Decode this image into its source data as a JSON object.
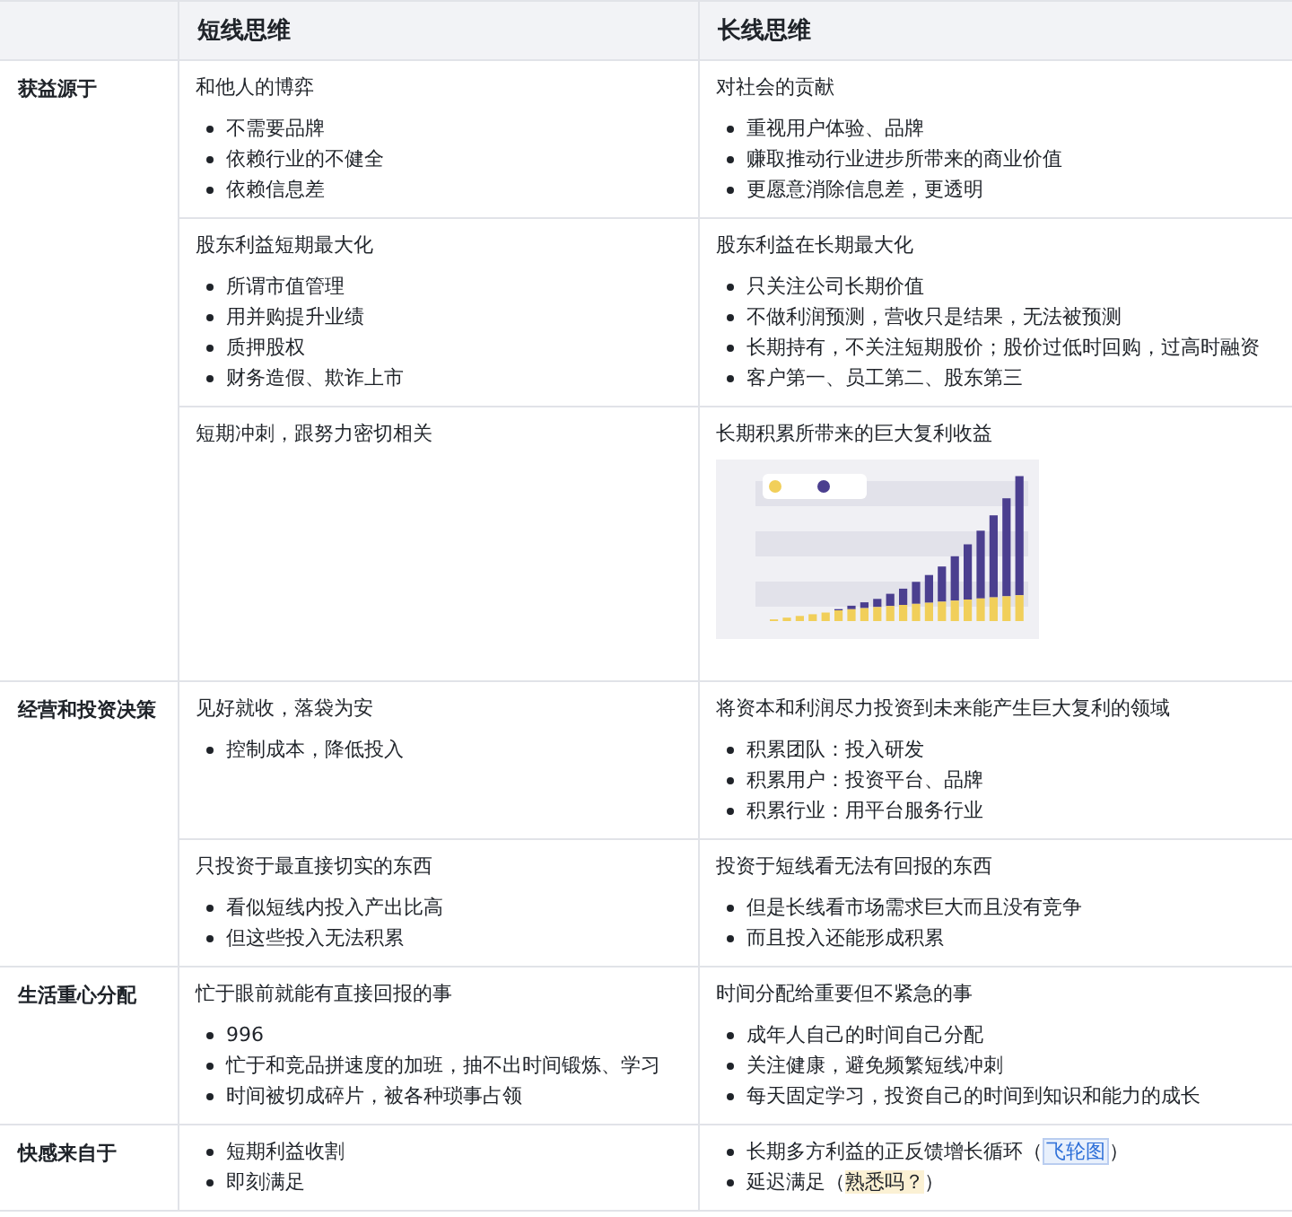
{
  "header": {
    "columns": [
      "短线思维",
      "长线思维"
    ]
  },
  "sections": [
    {
      "label": "获益源于",
      "rows": [
        {
          "short": {
            "title": "和他人的博弈",
            "bullets": [
              "不需要品牌",
              "依赖行业的不健全",
              "依赖信息差"
            ]
          },
          "long": {
            "title": "对社会的贡献",
            "bullets": [
              "重视用户体验、品牌",
              "赚取推动行业进步所带来的商业价值",
              "更愿意消除信息差，更透明"
            ]
          }
        },
        {
          "short": {
            "title": "股东利益短期最大化",
            "bullets": [
              "所谓市值管理",
              "用并购提升业绩",
              "质押股权",
              "财务造假、欺诈上市"
            ]
          },
          "long": {
            "title": "股东利益在长期最大化",
            "bullets": [
              "只关注公司长期价值",
              "不做利润预测，营收只是结果，无法被预测",
              "长期持有，不关注短期股价；股价过低时回购，过高时融资",
              "客户第一、员工第二、股东第三"
            ]
          }
        },
        {
          "short": {
            "title": "短期冲刺，跟努力密切相关"
          },
          "long": {
            "title": "长期积累所带来的巨大复利收益",
            "has_chart": true
          }
        }
      ]
    },
    {
      "label": "经营和投资决策",
      "rows": [
        {
          "short": {
            "title": "见好就收，落袋为安",
            "bullets": [
              "控制成本，降低投入"
            ]
          },
          "long": {
            "title": "将资本和利润尽力投资到未来能产生巨大复利的领域",
            "bullets": [
              "积累团队：投入研发",
              "积累用户：投资平台、品牌",
              "积累行业：用平台服务行业"
            ]
          }
        },
        {
          "short": {
            "title": "只投资于最直接切实的东西",
            "bullets": [
              "看似短线内投入产出比高",
              "但这些投入无法积累"
            ]
          },
          "long": {
            "title": "投资于短线看无法有回报的东西",
            "bullets": [
              "但是长线看市场需求巨大而且没有竞争",
              "而且投入还能形成积累"
            ]
          }
        }
      ]
    },
    {
      "label": "生活重心分配",
      "rows": [
        {
          "short": {
            "title": "忙于眼前就能有直接回报的事",
            "bullets": [
              "996",
              "忙于和竞品拼速度的加班，抽不出时间锻炼、学习",
              "时间被切成碎片，被各种琐事占领"
            ]
          },
          "long": {
            "title": "时间分配给重要但不紧急的事",
            "bullets": [
              "成年人自己的时间自己分配",
              "关注健康，避免频繁短线冲刺",
              "每天固定学习，投资自己的时间到知识和能力的成长"
            ]
          }
        }
      ]
    },
    {
      "label": "快感来自于",
      "rows": [
        {
          "short": {
            "bullets": [
              "短期利益收割",
              "即刻满足"
            ]
          },
          "long": {
            "bullets": [
              [
                {
                  "kind": "plain",
                  "text": "长期多方利益的正反馈增长循环（"
                },
                {
                  "kind": "link",
                  "text": "飞轮图"
                },
                {
                  "kind": "plain",
                  "text": "）"
                }
              ],
              [
                {
                  "kind": "plain",
                  "text": "延迟满足（"
                },
                {
                  "kind": "highlight",
                  "text": "熟悉吗？"
                },
                {
                  "kind": "plain",
                  "text": "）"
                }
              ]
            ]
          }
        }
      ]
    }
  ]
}
